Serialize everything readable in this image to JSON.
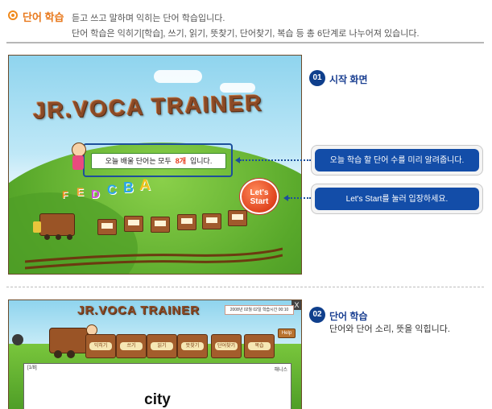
{
  "header": {
    "title": "단어 학습",
    "desc_line1": "듣고 쓰고 말하며 익히는 단어 학습입니다.",
    "desc_line2": "단어 학습은 익히기[학습], 쓰기, 읽기, 뜻찾기, 단어찾기, 복습 등 총 6단계로 나누어져 있습니다."
  },
  "screen1": {
    "logo": "JR.VOCA TRAINER",
    "notice_prefix": "오늘 배울 단어는 모두",
    "notice_count": "8개",
    "notice_suffix": "입니다.",
    "start_button_line1": "Let's",
    "start_button_line2": "Start",
    "letters": [
      "F",
      "E",
      "D",
      "C",
      "B",
      "A"
    ],
    "letter_colors": [
      "#f08a1c",
      "#f4a43a",
      "#d04ed6",
      "#2aa6e8",
      "#2aa6e8",
      "#f0c21c"
    ]
  },
  "callouts": [
    {
      "text": "오늘 학습 할 단어 수를 미리 알려줍니다."
    },
    {
      "text": "Let's Start를 눌러 입장하세요."
    }
  ],
  "steps": [
    {
      "number": "01",
      "title": "시작 화면"
    },
    {
      "number": "02",
      "title": "단어 학습",
      "desc": "단어와 단어 소리, 뜻을 익힙니다."
    }
  ],
  "screen2": {
    "close": "X",
    "logo": "JR.VOCA TRAINER",
    "date_text": "2008년 02월 02일 학습시간 00:10",
    "help_label": "Help",
    "car_labels": [
      "익히기",
      "쓰기",
      "읽기",
      "뜻찾기",
      "단어찾기",
      "복습"
    ],
    "panel_left": "[1/8]",
    "panel_right": "해니스",
    "word": "city"
  }
}
